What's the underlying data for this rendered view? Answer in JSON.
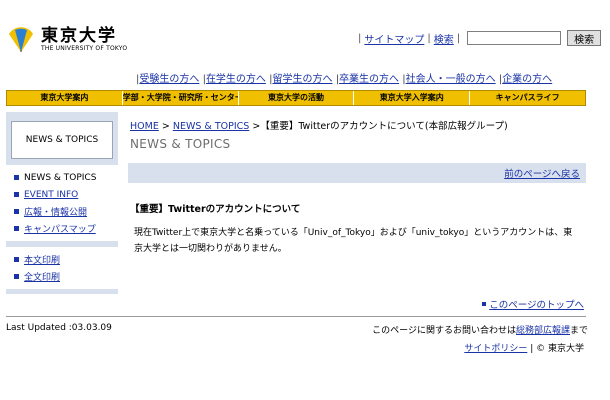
{
  "header": {
    "logo_jp": "東京大学",
    "logo_en": "THE UNIVERSITY OF TOKYO",
    "sitemap": "サイトマップ",
    "search_link": "検索",
    "search_value": "",
    "search_button": "検索"
  },
  "audience_links": [
    "受験生の方へ",
    "在学生の方へ",
    "留学生の方へ",
    "卒業生の方へ",
    "社会人・一般の方へ",
    "企業の方へ"
  ],
  "global_nav": [
    "東京大学案内",
    "学部・大学院・研究所・センター",
    "東京大学の活動",
    "東京大学入学案内",
    "キャンパスライフ"
  ],
  "sidebar": {
    "title": "NEWS & TOPICS",
    "items": [
      "NEWS & TOPICS",
      "EVENT INFO",
      "広報・情報公開",
      "キャンパスマップ"
    ],
    "print_items": [
      "本文印刷",
      "全文印刷"
    ]
  },
  "breadcrumb": {
    "home": "HOME",
    "sep": ">",
    "section": "NEWS & TOPICS",
    "current": "【重要】Twitterのアカウントについて(本部広報グループ)"
  },
  "page_heading": "NEWS & TOPICS",
  "back_link": "前のページへ戻る",
  "article": {
    "title": "【重要】Twitterのアカウントについて",
    "body": "現在Twitter上で東京大学と名乗っている「Univ_of_Tokyo」および「univ_tokyo」というアカウントは、東京大学とは一切関わりがありません。"
  },
  "to_top": "このページのトップへ",
  "footer": {
    "last_updated": "Last Updated :03.03.09",
    "contact_prefix": "このページに関するお問い合わせは",
    "contact_link": "総務部広報課",
    "contact_suffix": "まで",
    "policy_link": "サイトポリシー",
    "copyright": "© 東京大学"
  },
  "colors": {
    "nav_bg": "#f0c000",
    "sidebar_bg": "#d9e0ed",
    "link": "#1a33a6"
  }
}
